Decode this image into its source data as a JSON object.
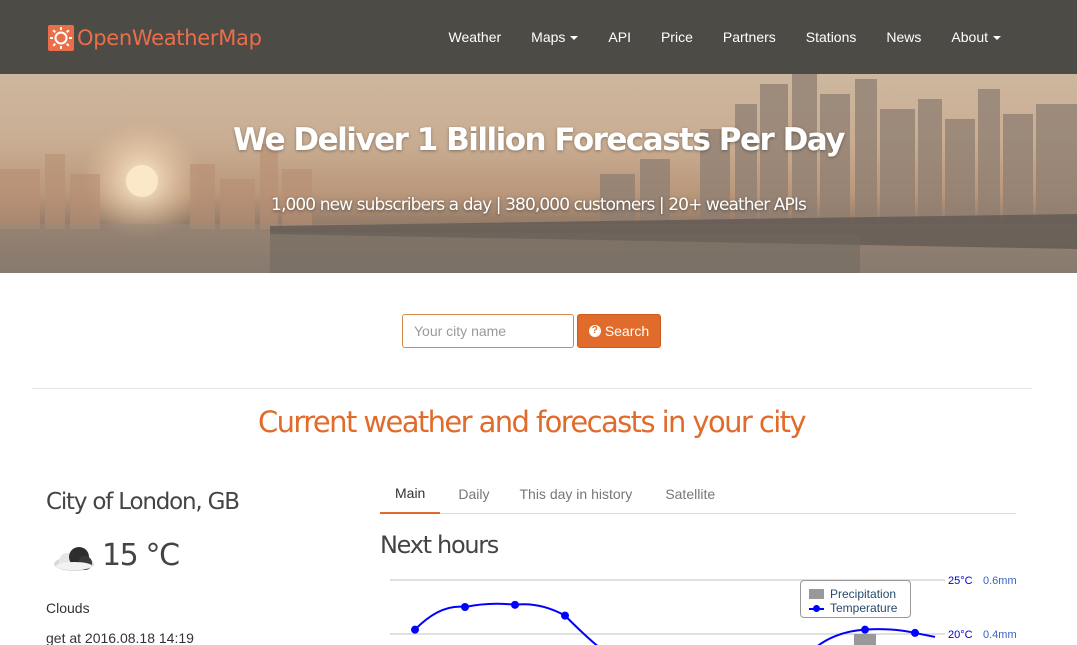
{
  "brand": {
    "name": "OpenWeatherMap",
    "color": "#eb6e4b"
  },
  "nav": {
    "items": [
      {
        "label": "Weather",
        "dropdown": false
      },
      {
        "label": "Maps",
        "dropdown": true
      },
      {
        "label": "API",
        "dropdown": false
      },
      {
        "label": "Price",
        "dropdown": false
      },
      {
        "label": "Partners",
        "dropdown": false
      },
      {
        "label": "Stations",
        "dropdown": false
      },
      {
        "label": "News",
        "dropdown": false
      },
      {
        "label": "About",
        "dropdown": true
      }
    ]
  },
  "hero": {
    "title": "We Deliver 1 Billion Forecasts Per Day",
    "subtitle": "1,000 new subscribers a day | 380,000 customers | 20+ weather APIs"
  },
  "search": {
    "placeholder": "Your city name",
    "button_label": "Search",
    "button_icon": "question-circle-icon",
    "accent": "#e06b2b"
  },
  "section": {
    "title": "Current weather and forecasts in your city"
  },
  "current": {
    "city": "City of London, GB",
    "icon": "cloud-icon",
    "temperature": "15 °C",
    "description": "Clouds",
    "get_at": "get at 2016.08.18 14:19"
  },
  "tabs": [
    {
      "label": "Main",
      "active": true
    },
    {
      "label": "Daily",
      "active": false
    },
    {
      "label": "This day in history",
      "active": false
    },
    {
      "label": "Satellite",
      "active": false
    }
  ],
  "forecast": {
    "heading": "Next hours"
  },
  "chart_data": {
    "type": "line",
    "title": "",
    "series": [
      {
        "name": "Precipitation",
        "type": "bar",
        "color": "#999999"
      },
      {
        "name": "Temperature",
        "type": "line",
        "color": "#0000ff"
      }
    ],
    "y_axis_left_ticks": [
      "25°C",
      "20°C"
    ],
    "y_axis_right_ticks": [
      "0.6mm",
      "0.4mm"
    ],
    "temperature_visible_points": [
      {
        "index": 0,
        "value": 20.4
      },
      {
        "index": 1,
        "value": 22.5
      },
      {
        "index": 2,
        "value": 22.7
      },
      {
        "index": 3,
        "value": 21.7
      },
      {
        "index": 9,
        "value": 20.4
      },
      {
        "index": 10,
        "value": 20.1
      }
    ],
    "grid": true,
    "legend": "top-right"
  }
}
